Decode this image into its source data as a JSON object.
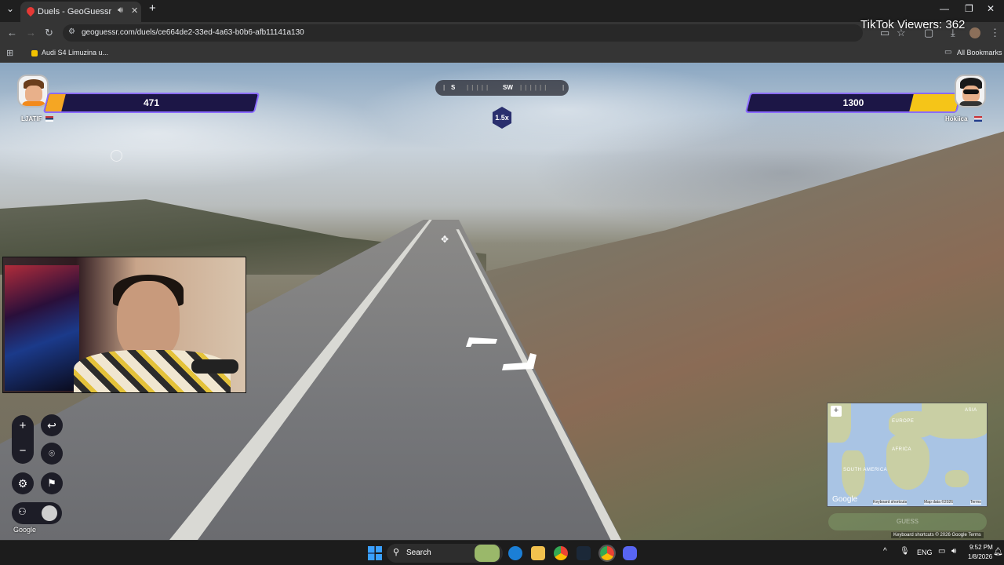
{
  "browser": {
    "tab_title": "Duels - GeoGuessr",
    "url": "geoguessr.com/duels/ce664de2-33ed-4a63-b0b6-afb11141a130",
    "bookmark": "Audi S4 Limuzina u...",
    "all_bookmarks": "All Bookmarks"
  },
  "overlay": {
    "tiktok_viewers": "TikTok Viewers: 362"
  },
  "game": {
    "player_left": {
      "name": "LJATIF",
      "health": "471",
      "health_fraction": 0.08
    },
    "player_right": {
      "name": "Hokiica",
      "health": "1300",
      "health_fraction": 0.22
    },
    "compass": {
      "left": "S",
      "center": "SW"
    },
    "multiplier": "1.5x"
  },
  "controls": {
    "google_label": "Google"
  },
  "minimap": {
    "labels": [
      "EUROPE",
      "ASIA",
      "AFRICA",
      "SOUTH AMERICA"
    ],
    "footer": [
      "Keyboard shortcuts",
      "Map data ©2026",
      "Terms"
    ],
    "guess_label": "GUESS"
  },
  "map_footer": "Keyboard shortcuts  © 2026 Google  Terms",
  "taskbar": {
    "search": "Search",
    "lang": "ENG",
    "time": "9:52 PM",
    "date": "1/8/2026"
  },
  "colors": {
    "health_left": "#f5a623",
    "health_right": "#f5c518",
    "health_border": "#8a6bff"
  }
}
